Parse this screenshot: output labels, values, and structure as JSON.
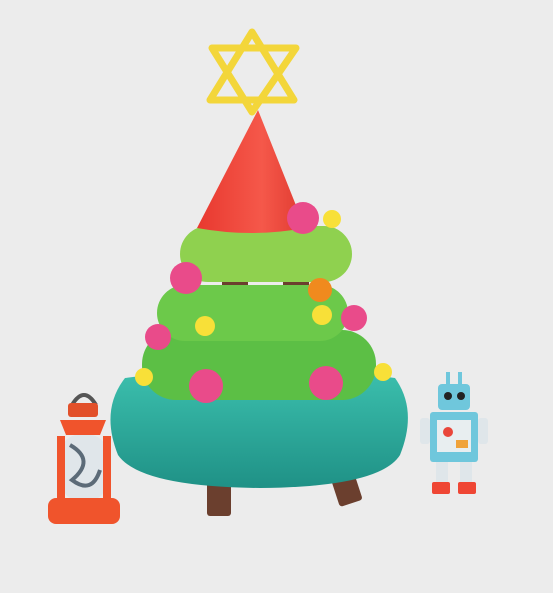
{
  "colors": {
    "background": "#ececec",
    "star": "#f3d63a",
    "tree_top": "#f2473a",
    "tier_light": "#8fd14f",
    "tier_mid": "#6cc94a",
    "tier_dark": "#5cbf45",
    "base": "#2aa99a",
    "trunk": "#6b3f2e",
    "ornament_pink": "#e94b8a",
    "ornament_yellow": "#f8e038",
    "ornament_orange": "#f08a1e",
    "lantern": "#f0542c",
    "robot": "#6fc7dc"
  }
}
